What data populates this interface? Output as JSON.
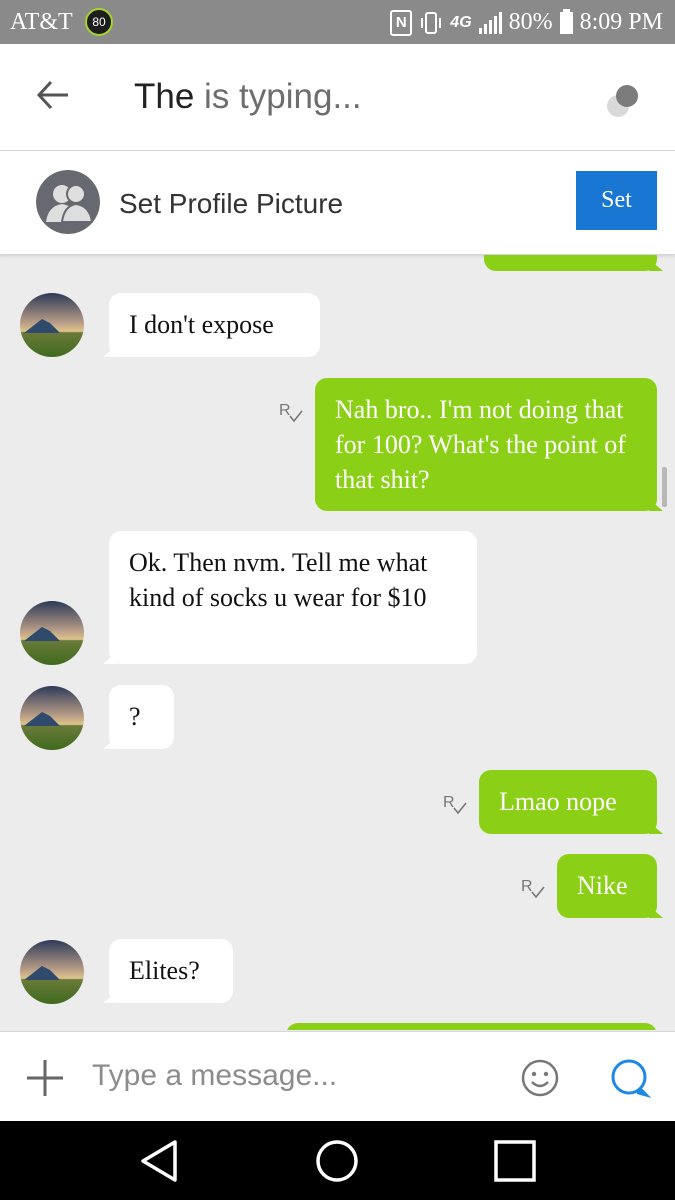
{
  "status_bar": {
    "carrier": "AT&T",
    "badge": "80",
    "nfc": "N",
    "network": "4G",
    "battery": "80%",
    "time": "8:09 PM"
  },
  "header": {
    "contact": "The",
    "typing": "is typing..."
  },
  "profile_banner": {
    "label": "Set Profile Picture",
    "button": "Set"
  },
  "messages": [
    {
      "direction": "incoming",
      "text": "I don't expose"
    },
    {
      "direction": "outgoing",
      "text": "Nah bro.. I'm not doing that for 100? What's the point of that shit?",
      "read": true
    },
    {
      "direction": "incoming",
      "text": "Ok. Then nvm. Tell me what kind of socks u wear for $10"
    },
    {
      "direction": "incoming",
      "text": "?"
    },
    {
      "direction": "outgoing",
      "text": "Lmao nope",
      "read": true
    },
    {
      "direction": "outgoing",
      "text": "Nike",
      "read": true
    },
    {
      "direction": "incoming",
      "text": "Elites?"
    }
  ],
  "composer": {
    "placeholder": "Type a message..."
  },
  "icons": {
    "back": "arrow-left-icon",
    "status": "status-dots-icon",
    "add": "plus-icon",
    "emoji": "smiley-icon",
    "send": "chat-bubble-icon",
    "nav": [
      "back-triangle-icon",
      "home-circle-icon",
      "recents-square-icon"
    ]
  },
  "colors": {
    "outgoing_bubble": "#8bd016",
    "incoming_bubble": "#ffffff",
    "set_button": "#1976d2",
    "chat_background": "#ececec",
    "send_icon": "#1e88e5"
  }
}
